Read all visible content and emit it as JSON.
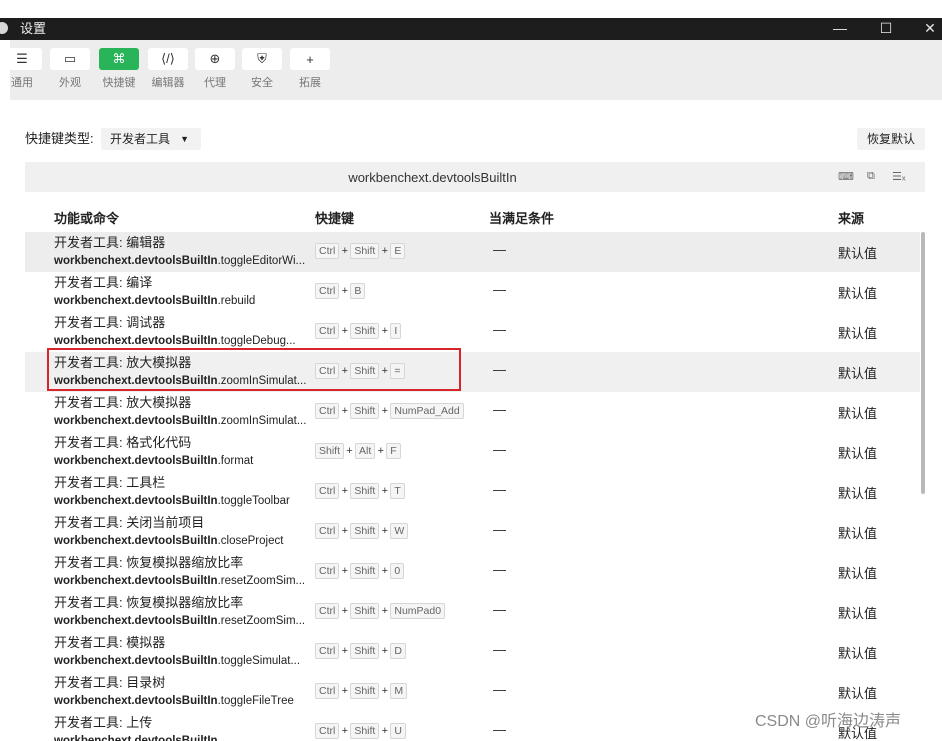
{
  "window": {
    "title": "设置",
    "minimize_glyph": "—",
    "maximize_glyph": "☐",
    "close_glyph": "✕"
  },
  "toolbar": {
    "tabs": [
      {
        "label": "通用",
        "icon": "list-icon",
        "glyph": "☰"
      },
      {
        "label": "外观",
        "icon": "window-icon",
        "glyph": "▭"
      },
      {
        "label": "快捷键",
        "icon": "command-icon",
        "glyph": "⌘"
      },
      {
        "label": "编辑器",
        "icon": "code-icon",
        "glyph": "⟨/⟩"
      },
      {
        "label": "代理",
        "icon": "globe-icon",
        "glyph": "⊕"
      },
      {
        "label": "安全",
        "icon": "shield-icon",
        "glyph": "⛨"
      },
      {
        "label": "拓展",
        "icon": "plus-icon",
        "glyph": "+"
      }
    ],
    "active": "快捷键"
  },
  "filters": {
    "type_label": "快捷键类型:",
    "type_value": "开发者工具",
    "restore_label": "恢复默认"
  },
  "group": {
    "title": "workbenchext.devtoolsBuiltIn"
  },
  "columns": {
    "command": "功能或命令",
    "shortcut": "快捷键",
    "when": "当满足条件",
    "source": "来源"
  },
  "rows": [
    {
      "title": "开发者工具: 编辑器",
      "ns": "workbenchext.devtoolsBuiltIn",
      "cmd": ".toggleEditorWi...",
      "keys": [
        "Ctrl",
        "Shift",
        "E"
      ],
      "when": "—",
      "source": "默认值"
    },
    {
      "title": "开发者工具: 编译",
      "ns": "workbenchext.devtoolsBuiltIn",
      "cmd": ".rebuild",
      "keys": [
        "Ctrl",
        "B"
      ],
      "when": "—",
      "source": "默认值"
    },
    {
      "title": "开发者工具: 调试器",
      "ns": "workbenchext.devtoolsBuiltIn",
      "cmd": ".toggleDebug...",
      "keys": [
        "Ctrl",
        "Shift",
        "I"
      ],
      "when": "—",
      "source": "默认值"
    },
    {
      "title": "开发者工具: 放大模拟器",
      "ns": "workbenchext.devtoolsBuiltIn",
      "cmd": ".zoomInSimulat...",
      "keys": [
        "Ctrl",
        "Shift",
        "="
      ],
      "when": "—",
      "source": "默认值"
    },
    {
      "title": "开发者工具: 放大模拟器",
      "ns": "workbenchext.devtoolsBuiltIn",
      "cmd": ".zoomInSimulat...",
      "keys": [
        "Ctrl",
        "Shift",
        "NumPad_Add"
      ],
      "when": "—",
      "source": "默认值"
    },
    {
      "title": "开发者工具: 格式化代码",
      "ns": "workbenchext.devtoolsBuiltIn",
      "cmd": ".format",
      "keys": [
        "Shift",
        "Alt",
        "F"
      ],
      "when": "—",
      "source": "默认值"
    },
    {
      "title": "开发者工具: 工具栏",
      "ns": "workbenchext.devtoolsBuiltIn",
      "cmd": ".toggleToolbar",
      "keys": [
        "Ctrl",
        "Shift",
        "T"
      ],
      "when": "—",
      "source": "默认值"
    },
    {
      "title": "开发者工具: 关闭当前项目",
      "ns": "workbenchext.devtoolsBuiltIn",
      "cmd": ".closeProject",
      "keys": [
        "Ctrl",
        "Shift",
        "W"
      ],
      "when": "—",
      "source": "默认值"
    },
    {
      "title": "开发者工具: 恢复模拟器缩放比率",
      "ns": "workbenchext.devtoolsBuiltIn",
      "cmd": ".resetZoomSim...",
      "keys": [
        "Ctrl",
        "Shift",
        "0"
      ],
      "when": "—",
      "source": "默认值"
    },
    {
      "title": "开发者工具: 恢复模拟器缩放比率",
      "ns": "workbenchext.devtoolsBuiltIn",
      "cmd": ".resetZoomSim...",
      "keys": [
        "Ctrl",
        "Shift",
        "NumPad0"
      ],
      "when": "—",
      "source": "默认值"
    },
    {
      "title": "开发者工具: 模拟器",
      "ns": "workbenchext.devtoolsBuiltIn",
      "cmd": ".toggleSimulat...",
      "keys": [
        "Ctrl",
        "Shift",
        "D"
      ],
      "when": "—",
      "source": "默认值"
    },
    {
      "title": "开发者工具: 目录树",
      "ns": "workbenchext.devtoolsBuiltIn",
      "cmd": ".toggleFileTree",
      "keys": [
        "Ctrl",
        "Shift",
        "M"
      ],
      "when": "—",
      "source": "默认值"
    },
    {
      "title": "开发者工具: 上传",
      "ns": "workbenchext.devtoolsBuiltIn",
      "cmd": "",
      "keys": [
        "Ctrl",
        "Shift",
        "U"
      ],
      "when": "—",
      "source": "默认值"
    }
  ],
  "selected_row": 3,
  "watermark": "CSDN @听海边涛声",
  "colors": {
    "accent": "#29b45a",
    "highlight": "#d6262c"
  }
}
